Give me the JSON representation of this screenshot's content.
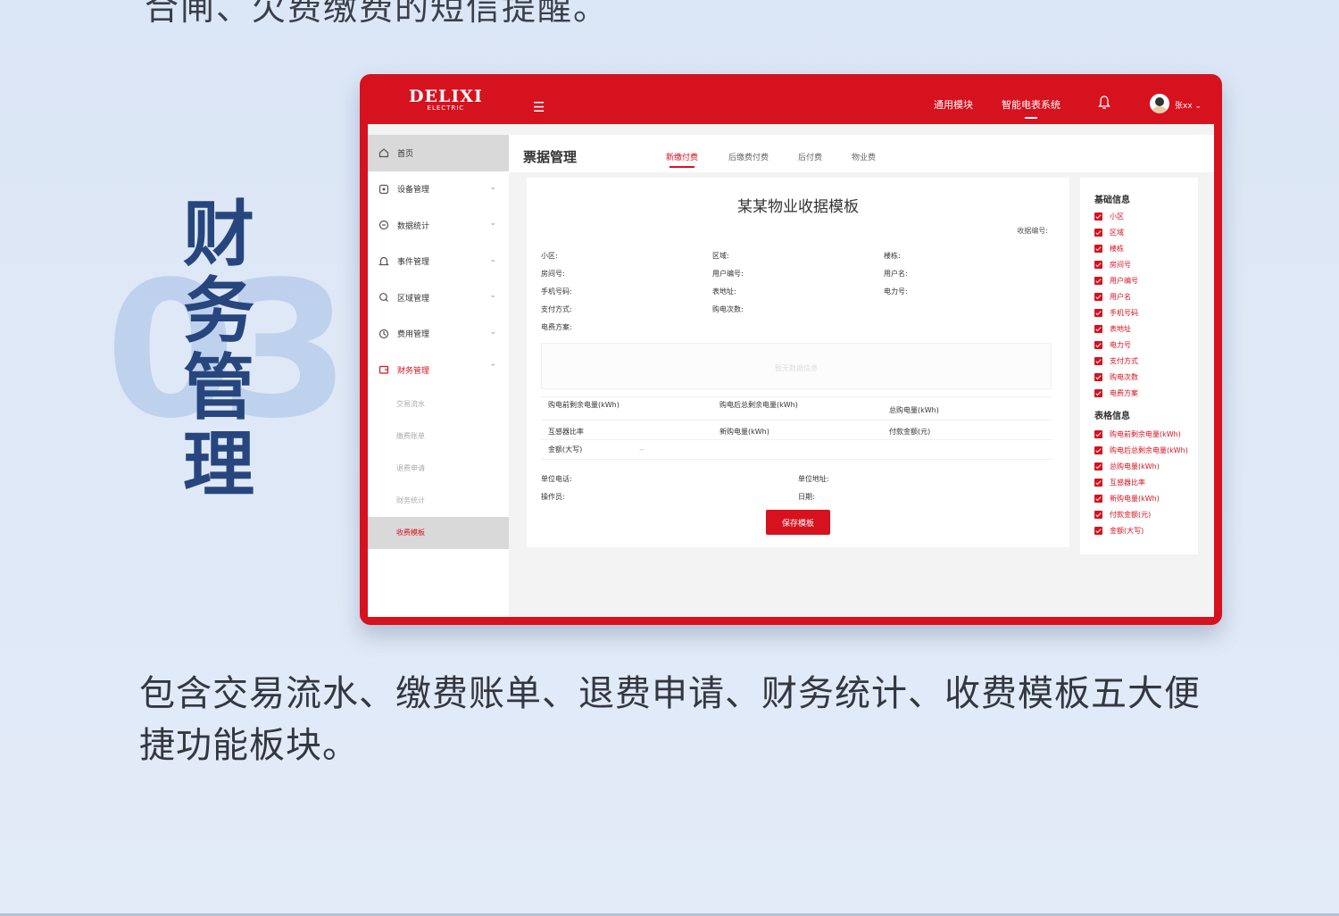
{
  "top_text": "合闸、欠费缴费的短信提醒。",
  "section_number": "03",
  "section_title": "财务管理",
  "bottom_text": "包含交易流水、缴费账单、退费申请、财务统计、收费模板五大便捷功能板块。",
  "app": {
    "logo": "DELIXI",
    "logo_sub": "ELECTRIC",
    "top_links": [
      "通用模块",
      "智能电表系统"
    ],
    "user_name": "张xx",
    "sidebar": [
      {
        "label": "首页",
        "icon": "home-icon",
        "selected": true
      },
      {
        "label": "设备管理",
        "icon": "device-icon"
      },
      {
        "label": "数据统计",
        "icon": "stats-icon"
      },
      {
        "label": "事件管理",
        "icon": "event-icon"
      },
      {
        "label": "区域管理",
        "icon": "area-icon"
      },
      {
        "label": "费用管理",
        "icon": "fee-icon"
      },
      {
        "label": "财务管理",
        "icon": "finance-icon",
        "active": true
      }
    ],
    "sub_items": [
      "交易流水",
      "缴费账单",
      "退费申请",
      "财务统计",
      "收费模板"
    ],
    "page_title": "票据管理",
    "tabs": [
      "新缴付费",
      "后缴费付费",
      "后付费",
      "物业费"
    ],
    "card": {
      "title": "某某物业收据模板",
      "receipt_no": "收据编号:",
      "fields": [
        "小区:",
        "区域:",
        "楼栋:",
        "房间号:",
        "用户编号:",
        "用户名:",
        "手机号码:",
        "表地址:",
        "电力号:",
        "支付方式:",
        "购电次数:",
        "电费方案:"
      ],
      "placeholder": "暂无数据信息",
      "table_headers": [
        "购电前剩余电量(kWh)",
        "购电后总剩余电量(kWh)",
        "总购电量(kWh)"
      ],
      "table_row2": [
        "互感器比率",
        "新购电量(kWh)",
        "付款金额(元)"
      ],
      "table_row3": [
        "金额(大写)",
        "--"
      ],
      "footer_fields": [
        "单位电话:",
        "单位地址:",
        "操作员:",
        "日期:"
      ],
      "save_label": "保存模板"
    },
    "right_panel": {
      "basic_title": "基础信息",
      "basic_items": [
        "小区",
        "区域",
        "楼栋",
        "房间号",
        "用户编号",
        "用户名",
        "手机号码",
        "表地址",
        "电力号",
        "支付方式",
        "购电次数",
        "电费方案"
      ],
      "table_title": "表格信息",
      "table_items": [
        "购电前剩余电量(kWh)",
        "购电后总剩余电量(kWh)",
        "总购电量(kWh)",
        "互感器比率",
        "新购电量(kWh)",
        "付款金额(元)",
        "金额(大写)"
      ]
    }
  },
  "colors": {
    "brand_red": "#d6121f",
    "title_blue": "#27467e",
    "background": "#dbe6f6"
  }
}
